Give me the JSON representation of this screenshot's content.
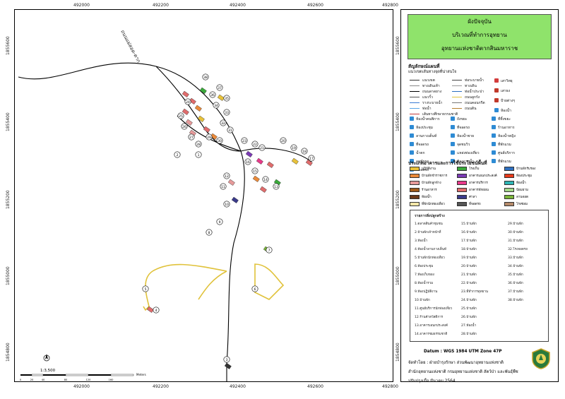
{
  "title": {
    "line1": "ผังปัจจุบัน",
    "line2": "บริเวณที่ทำการอุทยาน",
    "line3": "อุทยานแห่งชาติตากสินมหาราช"
  },
  "grid": {
    "x_labels": [
      "492000",
      "492200",
      "492400",
      "492600",
      "492800"
    ],
    "y_labels": [
      "1855600",
      "1855400",
      "1855200",
      "1855000",
      "1854800"
    ]
  },
  "map": {
    "road_label": "ถนนแม่สอด-ตาก",
    "scale_text": "1:3,500",
    "scale_ticks": [
      "0",
      "20",
      "40",
      "80",
      "120",
      "160"
    ],
    "scale_unit": "Meters",
    "markers": [
      "38",
      "37",
      "36",
      "35",
      "34",
      "33",
      "32",
      "31",
      "30",
      "29",
      "28",
      "27",
      "26",
      "25",
      "24",
      "23",
      "22",
      "21",
      "20",
      "19",
      "18",
      "17",
      "16",
      "15",
      "14",
      "13",
      "12",
      "11",
      "10",
      "9",
      "8",
      "7",
      "6",
      "5",
      "4",
      "3",
      "2",
      "1"
    ]
  },
  "legend": {
    "heading": "สัญลักษณ์แผนที่",
    "subheading": "แนวเขตเส้นทางจุดที่น่าสนใจ",
    "lines": [
      {
        "label": "แนวเขต",
        "color": "#333333"
      },
      {
        "label": "ทางเดินเท้า",
        "color": "#888888"
      },
      {
        "label": "ถนนลาดยาง",
        "color": "#000000"
      },
      {
        "label": "แนวรั้ว",
        "color": "#555555"
      },
      {
        "label": "รางระบายน้ำ",
        "color": "#3a7bd5"
      },
      {
        "label": "ท่อน้ำ",
        "color": "#5aa5e6"
      },
      {
        "label": "เส้นทางศึกษาธรรมชาติ",
        "color": "#c33a3a"
      }
    ],
    "lines2": [
      {
        "label": "ท่อระบายน้ำ",
        "color": "#444444"
      },
      {
        "label": "ทางเดิน",
        "color": "#999999"
      },
      {
        "label": "ท่อน้ำประปา",
        "color": "#2c6fbf"
      },
      {
        "label": "ถนนลูกรัง",
        "color": "#e0c23a"
      },
      {
        "label": "ถนนคอนกรีต",
        "color": "#777777"
      },
      {
        "label": "ถนนดิน",
        "color": "#b57f2d"
      }
    ],
    "points": [
      {
        "label": "เสาวิทยุ",
        "color": "#d33c3c"
      },
      {
        "label": "เสาธง",
        "color": "#c0392b"
      },
      {
        "label": "ป้ายต่างๆ",
        "color": "#c0392b"
      },
      {
        "label": "ห้องน้ำ",
        "color": "#2e8bd4"
      },
      {
        "label": "ห้องน้ำคนพิการ",
        "color": "#2e8bd4"
      },
      {
        "label": "ถังขยะ",
        "color": "#2e8bd4"
      },
      {
        "label": "ที่ทิ้งขยะ",
        "color": "#2e8bd4"
      },
      {
        "label": "ห้องประชุม",
        "color": "#2e8bd4"
      },
      {
        "label": "ที่จอดรถ",
        "color": "#2e8bd4"
      },
      {
        "label": "ร้านอาหาร",
        "color": "#2e8bd4"
      },
      {
        "label": "ลานกางเต็นท์",
        "color": "#2e8bd4"
      },
      {
        "label": "ห้องน้ำชาย",
        "color": "#2e8bd4"
      },
      {
        "label": "ห้องน้ำหญิง",
        "color": "#2e8bd4"
      },
      {
        "label": "ที่จอดรถ",
        "color": "#2e8bd4"
      },
      {
        "label": "จุดชมวิว",
        "color": "#2e8bd4"
      },
      {
        "label": "ที่พักแรม",
        "color": "#2e8bd4"
      },
      {
        "label": "น้ำตก",
        "color": "#2e8bd4"
      },
      {
        "label": "แหล่งท่องเที่ยว",
        "color": "#2e8bd4"
      },
      {
        "label": "ศูนย์บริการ",
        "color": "#2e8bd4"
      },
      {
        "label": "จุดพักรถ",
        "color": "#2e8bd4"
      },
      {
        "label": "ห้องอาบน้ำ",
        "color": "#2e8bd4"
      },
      {
        "label": "ที่พักแรม",
        "color": "#2e8bd4"
      },
      {
        "label": "ที่จอดรถ",
        "color": "#2e8bd4"
      }
    ],
    "landuse_heading": "ประเภทอาคารและการใช้ประโยชน์พื้นที่",
    "landuse": [
      {
        "label": "ปฏิบัติงาน",
        "color": "#e8c23a"
      },
      {
        "label": "บ้านพักข้าราชการ",
        "color": "#ea8a3a"
      },
      {
        "label": "บ้านพักลูกจ้าง",
        "color": "#e69a9a"
      },
      {
        "label": "ร้านอาหาร",
        "color": "#a05a1a"
      },
      {
        "label": "ห้องน้ำ",
        "color": "#6b3a1a"
      },
      {
        "label": "ที่พักนักท่องเที่ยว",
        "color": "#f4e7a8"
      },
      {
        "label": "โรงเก็บ",
        "color": "#3aaa3a"
      },
      {
        "label": "อาคารเอนกประสงค์",
        "color": "#7b3ab5"
      },
      {
        "label": "อาคารบริการ",
        "color": "#e83a8a"
      },
      {
        "label": "อาคารพักผ่อน",
        "color": "#e06c6c"
      },
      {
        "label": "ศาลา",
        "color": "#3a3a8a"
      },
      {
        "label": "ที่จอดรถ",
        "color": "#555555"
      },
      {
        "label": "บ้านพักรับรอง",
        "color": "#2e6fbf"
      },
      {
        "label": "ห้องประชุม",
        "color": "#e83a1a"
      },
      {
        "label": "ห้องน้ำ",
        "color": "#2eb5b5"
      },
      {
        "label": "ป้อมยาม",
        "color": "#a5d88a"
      },
      {
        "label": "ลานจอด",
        "color": "#7bb53a"
      },
      {
        "label": "โรงซ่อม",
        "color": "#b58a6a"
      }
    ]
  },
  "places": {
    "heading": "รายการสิ่งปลูกสร้าง",
    "col1": [
      "1.ตลาดสินค้าชุมชน",
      "2.บ้านพักเจ้าหน้าที่",
      "3.ห้องน้ำ",
      "4.ห้องน้ำลานกางเต็นท์",
      "5.บ้านพักนักท่องเที่ยว",
      "6.ห้องประชุม",
      "7.ห้องเก็บของ",
      "8.ห้องน้ำรวม",
      "9.ห้องปฏิบัติงาน",
      "10.บ้านพัก",
      "11.ศูนย์บริการนักท่องเที่ยว",
      "12.ร้านค้าสวัสดิการ",
      "13.อาคารเอนกประสงค์",
      "14.อาคารชมธรรมชาติ"
    ],
    "col2": [
      "15.บ้านพัก",
      "16.บ้านพัก",
      "17.บ้านพัก",
      "18.บ้านพัก",
      "19.บ้านพัก",
      "20.บ้านพัก",
      "21.บ้านพัก",
      "22.บ้านพัก",
      "23.ที่ทำการอุทยาน",
      "24.บ้านพัก",
      "25.บ้านพัก",
      "26.บ้านพัก",
      "27.ห้องน้ำ",
      "28.บ้านพัก"
    ],
    "col3": [
      "29.บ้านพัก",
      "30.บ้านพัก",
      "31.บ้านพัก",
      "32.โรงจอดรถ",
      "33.บ้านพัก",
      "34.บ้านพัก",
      "35.บ้านพัก",
      "36.บ้านพัก",
      "37.บ้านพัก",
      "38.บ้านพัก"
    ]
  },
  "footer": {
    "datum": "Datum  : WGS 1984 UTM Zone 47P",
    "credit1": "จัดทำโดย  : ฝ่ายบำรุงรักษา ส่วนพัฒนาอุทยานแห่งชาติ",
    "credit2": "สำนักอุทยานแห่งชาติ  กรมอุทยานแห่งชาติ สัตว์ป่า และพันธุ์พืช",
    "credit3": "ปรับปรุงเมื่อ มีนาคม 2564"
  }
}
